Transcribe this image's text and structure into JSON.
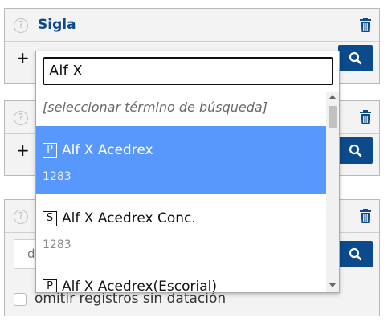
{
  "colors": {
    "accent": "#0b4a8b",
    "selected": "#5897fb"
  },
  "panels": [
    {
      "title": "Sigla",
      "help_icon": "?",
      "add_label": "+"
    },
    {
      "help_icon": "?",
      "add_label": "+"
    },
    {
      "help_icon": "?",
      "input_value": "d"
    }
  ],
  "omit": {
    "label": "omitir registros sin datación"
  },
  "dropdown": {
    "search_value": "Alf X",
    "placeholder": "[seleccionar término de búsqueda]",
    "items": [
      {
        "badge": "P",
        "name": "Alf X Acedrex",
        "year": "1283",
        "selected": true
      },
      {
        "badge": "S",
        "name": "Alf X Acedrex Conc.",
        "year": "1283",
        "selected": false
      },
      {
        "badge": "P",
        "name": "Alf X Acedrex(Escorial)",
        "year": "",
        "selected": false
      }
    ]
  }
}
